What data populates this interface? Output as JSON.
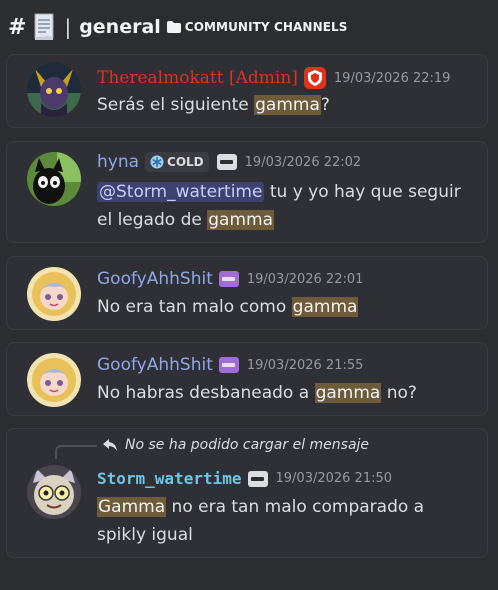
{
  "header": {
    "hash": "#",
    "separator": "|",
    "channel": "general",
    "category": "COMMUNITY CHANNELS"
  },
  "messages": [
    {
      "username": "Therealmokatt [Admin]",
      "timestamp": "19/03/2026 22:19",
      "parts": [
        "Serás el siguiente ",
        "gamma",
        "?"
      ]
    },
    {
      "username": "hyna",
      "tag": "COLD",
      "timestamp": "19/03/2026 22:02",
      "mention": "@Storm_watertime",
      "line1_rest": " tu y yo hay que seguir",
      "line2": [
        "el legado de ",
        "gamma"
      ]
    },
    {
      "username": "GoofyAhhShit",
      "timestamp": "19/03/2026 22:01",
      "parts": [
        "No era tan malo como ",
        "gamma"
      ]
    },
    {
      "username": "GoofyAhhShit",
      "timestamp": "19/03/2026 21:55",
      "parts": [
        "No habras desbaneado a ",
        "gamma",
        " no?"
      ]
    },
    {
      "reply_text": "No se ha podido cargar el mensaje",
      "username": "Storm_watertime",
      "timestamp": "19/03/2026 21:50",
      "line1": [
        "Gamma",
        " no era tan malo comparado a"
      ],
      "line2": "spikly igual"
    }
  ],
  "colors": {
    "background": "#2b2d31",
    "admin_name": "#e0321e",
    "blue_name": "#8ea8ea",
    "cyan_name": "#6cc6e8",
    "highlight": "#6e5b3a"
  },
  "icons": [
    "doc-icon",
    "folder-icon",
    "shield-icon",
    "snowflake-icon",
    "server-tag-icon",
    "reply-arrow-icon"
  ]
}
